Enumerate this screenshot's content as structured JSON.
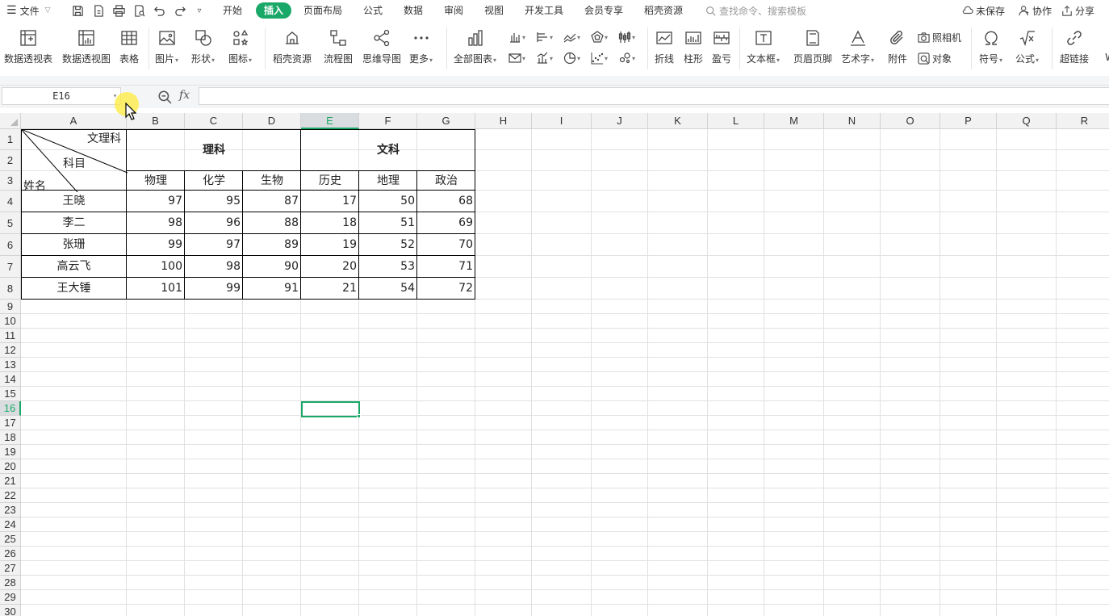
{
  "menubar": {
    "file_label": "文件",
    "tabs": [
      {
        "label": "开始",
        "active": false
      },
      {
        "label": "插入",
        "active": true
      },
      {
        "label": "页面布局",
        "active": false
      },
      {
        "label": "公式",
        "active": false
      },
      {
        "label": "数据",
        "active": false
      },
      {
        "label": "审阅",
        "active": false
      },
      {
        "label": "视图",
        "active": false
      },
      {
        "label": "开发工具",
        "active": false
      },
      {
        "label": "会员专享",
        "active": false
      },
      {
        "label": "稻壳资源",
        "active": false
      }
    ],
    "search_placeholder": "查找命令、搜索模板",
    "unsaved": "未保存",
    "collaborate": "协作",
    "share": "分享",
    "accent_color": "#1aa868"
  },
  "ribbon": {
    "pivot_table": "数据透视表",
    "pivot_chart": "数据透视图",
    "table": "表格",
    "picture": "图片",
    "shape": "形状",
    "icon": "图标",
    "docer_resource": "稻壳资源",
    "flowchart": "流程图",
    "mindmap": "思维导图",
    "more": "更多",
    "all_charts": "全部图表",
    "sparkline_line": "折线",
    "sparkline_column": "柱形",
    "sparkline_winloss": "盈亏",
    "textbox": "文本框",
    "header_footer": "页眉页脚",
    "wordart": "艺术字",
    "attachment": "附件",
    "camera": "照相机",
    "object": "对象",
    "symbol": "符号",
    "formula": "公式",
    "hyperlink": "超链接",
    "truncated": "W"
  },
  "formula_bar": {
    "cell_ref": "E16",
    "fx_label": "fx",
    "content": ""
  },
  "sheet": {
    "columns": [
      "A",
      "B",
      "C",
      "D",
      "E",
      "F",
      "G",
      "H",
      "I",
      "J",
      "K",
      "L",
      "M",
      "N",
      "O",
      "P",
      "Q",
      "R"
    ],
    "selected_column": "E",
    "rows": [
      "1",
      "2",
      "3",
      "4",
      "5",
      "6",
      "7",
      "8",
      "9",
      "10",
      "11",
      "12",
      "13",
      "14",
      "15",
      "16",
      "17",
      "18",
      "19",
      "20",
      "21",
      "22",
      "23",
      "24",
      "25",
      "26",
      "27",
      "28",
      "29",
      "30"
    ],
    "selected_row": "16",
    "diag_header": {
      "top": "文理科",
      "middle": "科目",
      "bottom": "姓名"
    },
    "group_science": "理科",
    "group_arts": "文科",
    "subjects": [
      "物理",
      "化学",
      "生物",
      "历史",
      "地理",
      "政治"
    ],
    "students": [
      {
        "name": "王晓",
        "scores": [
          "97",
          "95",
          "87",
          "17",
          "50",
          "68"
        ]
      },
      {
        "name": "李二",
        "scores": [
          "98",
          "96",
          "88",
          "18",
          "51",
          "69"
        ]
      },
      {
        "name": "张珊",
        "scores": [
          "99",
          "97",
          "89",
          "19",
          "52",
          "70"
        ]
      },
      {
        "name": "高云飞",
        "scores": [
          "100",
          "98",
          "90",
          "20",
          "53",
          "71"
        ]
      },
      {
        "name": "王大锤",
        "scores": [
          "101",
          "99",
          "91",
          "21",
          "54",
          "72"
        ]
      }
    ]
  }
}
